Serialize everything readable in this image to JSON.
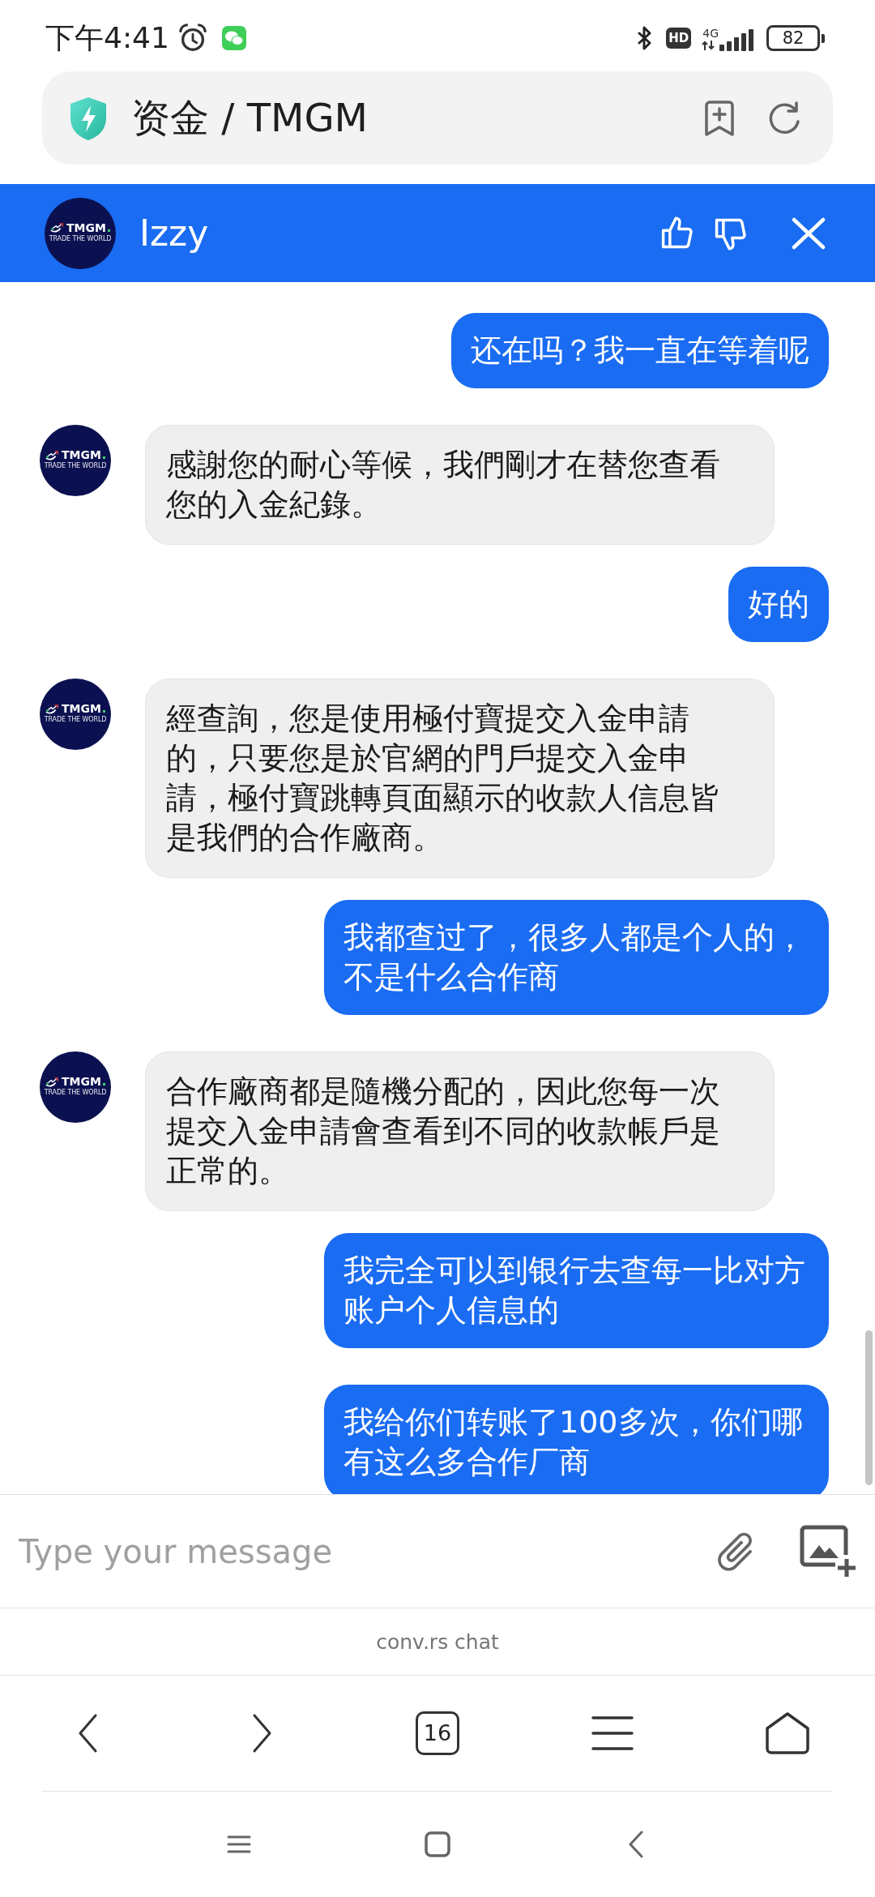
{
  "status_bar": {
    "time": "下午4:41",
    "hd": "HD",
    "network": "4G",
    "battery": "82"
  },
  "address_bar": {
    "title": "资金 / TMGM"
  },
  "chat_header": {
    "avatar": {
      "wordmark": "TMGM",
      "tagline": "TRADE THE WORLD"
    },
    "agent_name": "Izzy"
  },
  "messages": [
    {
      "kind": "user",
      "text": "还在吗？我一直在等着呢"
    },
    {
      "kind": "agent",
      "avatar": {
        "wordmark": "TMGM",
        "tagline": "TRADE THE WORLD"
      },
      "text": "感謝您的耐心等候，我們剛才在替您查看您的入金紀錄。"
    },
    {
      "kind": "user",
      "text": "好的"
    },
    {
      "kind": "agent",
      "avatar": {
        "wordmark": "TMGM",
        "tagline": "TRADE THE WORLD"
      },
      "text": "經查詢，您是使用極付寶提交入金申請的，只要您是於官網的門戶提交入金申請，極付寶跳轉頁面顯示的收款人信息皆是我們的合作廠商。"
    },
    {
      "kind": "user",
      "text": "我都查过了，很多人都是个人的，不是什么合作商"
    },
    {
      "kind": "agent",
      "avatar": {
        "wordmark": "TMGM",
        "tagline": "TRADE THE WORLD"
      },
      "text": "合作廠商都是隨機分配的，因此您每一次提交入金申請會查看到不同的收款帳戶是正常的。"
    },
    {
      "kind": "user",
      "text": "我完全可以到银行去查每一比对方账户个人信息的"
    },
    {
      "kind": "user",
      "text": "我给你们转账了100多次，你们哪有这么多合作厂商"
    }
  ],
  "composer": {
    "placeholder": "Type your message"
  },
  "footer": {
    "branding": "conv.rs chat"
  },
  "browser_toolbar": {
    "tab_count": "16"
  }
}
